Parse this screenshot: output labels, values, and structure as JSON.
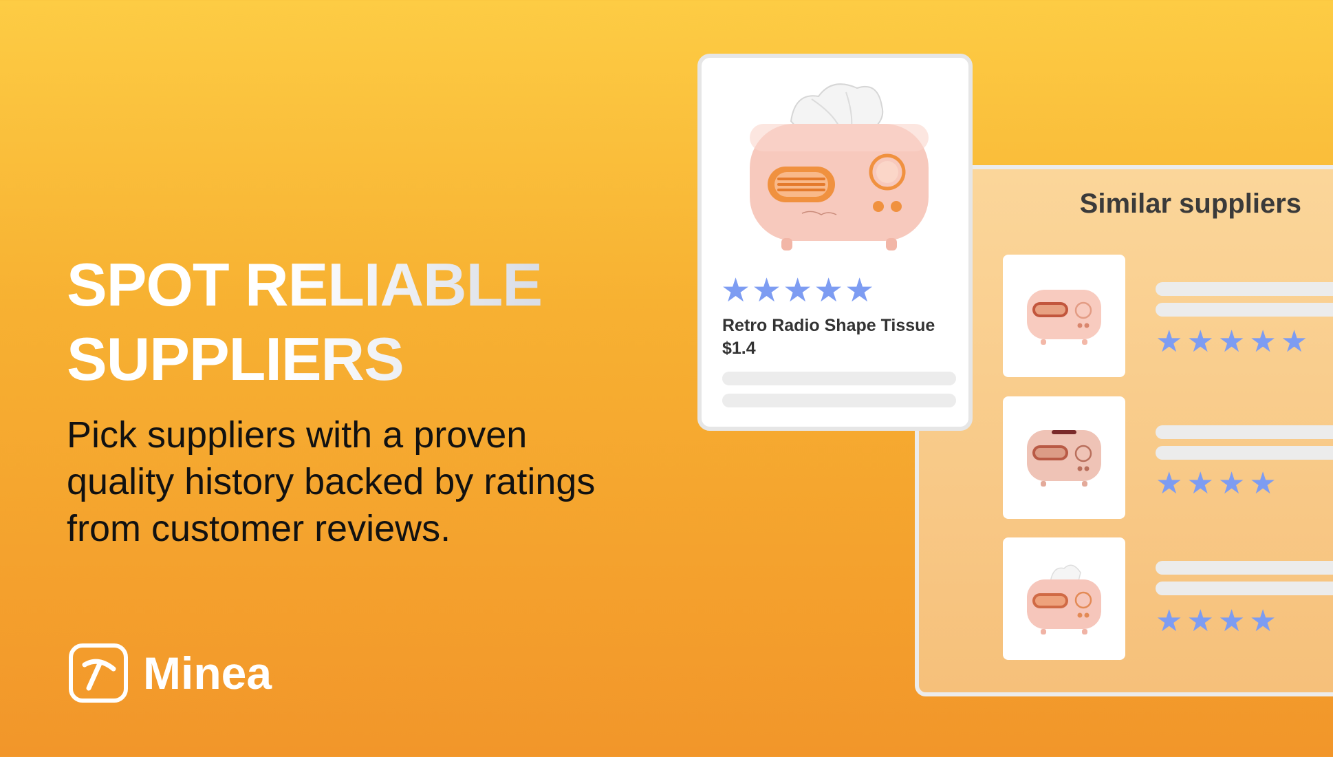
{
  "hero": {
    "headline_line1": "SPOT RELIABLE",
    "headline_line2": "SUPPLIERS",
    "subtitle_line1": "Pick suppliers with a proven",
    "subtitle_line2": "quality history backed by ratings",
    "subtitle_line3": "from customer reviews."
  },
  "brand": {
    "name": "Minea",
    "icon": "pickaxe-icon"
  },
  "product_card": {
    "name": "Retro Radio Shape Tissue",
    "price": "$1.4",
    "rating": 5,
    "rating_max": 5,
    "image": "retro-radio-tissue-box-image"
  },
  "similar_suppliers": {
    "title": "Similar suppliers",
    "suppliers": [
      {
        "rating": 5,
        "image": "radio-tissue-box-thumbnail"
      },
      {
        "rating": 4,
        "image": "radio-tissue-box-thumbnail"
      },
      {
        "rating": 4,
        "image": "radio-tissue-box-with-tissue-thumbnail"
      }
    ]
  },
  "colors": {
    "background_top": "#fdcc44",
    "background_bottom": "#f2962a",
    "star": "#7d9cf2",
    "placeholder_bar": "#ececec",
    "product_pink": "#f7c9bd",
    "product_orange": "#f0913f"
  }
}
